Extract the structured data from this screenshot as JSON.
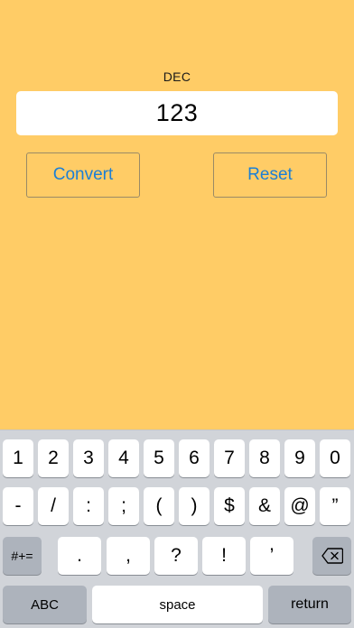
{
  "converter": {
    "label": "DEC",
    "value": "123",
    "convert_label": "Convert",
    "reset_label": "Reset"
  },
  "keyboard": {
    "row1": [
      "1",
      "2",
      "3",
      "4",
      "5",
      "6",
      "7",
      "8",
      "9",
      "0"
    ],
    "row2": [
      "-",
      "/",
      ":",
      ";",
      "(",
      ")",
      "$",
      "&",
      "@",
      "”"
    ],
    "row3": [
      ".",
      ",",
      "?",
      "!",
      "’"
    ],
    "more_symbols": "#+=",
    "abc": "ABC",
    "space": "space",
    "return": "return",
    "backspace_icon": "backspace-icon"
  },
  "colors": {
    "background": "#ffcc66",
    "accent": "#1b7fd6",
    "keyboard_bg": "#d1d4d9"
  }
}
